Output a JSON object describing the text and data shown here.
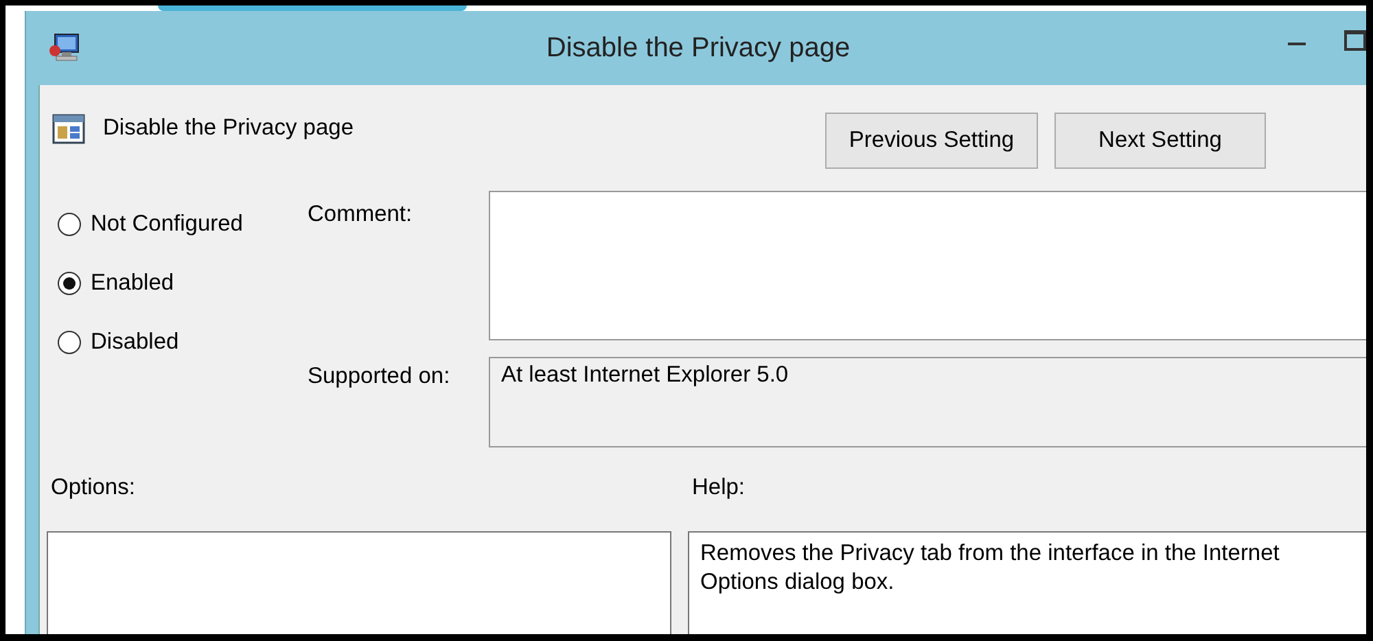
{
  "window": {
    "title": "Disable the Privacy page"
  },
  "policy": {
    "name": "Disable the Privacy page"
  },
  "buttons": [
    {
      "label": "Previous Setting"
    },
    {
      "label": "Next Setting"
    }
  ],
  "state_options": [
    {
      "label": "Not Configured",
      "selected": false
    },
    {
      "label": "Enabled",
      "selected": true
    },
    {
      "label": "Disabled",
      "selected": false
    }
  ],
  "comment": {
    "label": "Comment:"
  },
  "supported_on": {
    "label": "Supported on:",
    "value": "At least Internet Explorer 5.0"
  },
  "options": {
    "label": "Options:"
  },
  "help": {
    "label": "Help:",
    "text": "Removes the Privacy tab from the interface in the Internet Options dialog box."
  }
}
